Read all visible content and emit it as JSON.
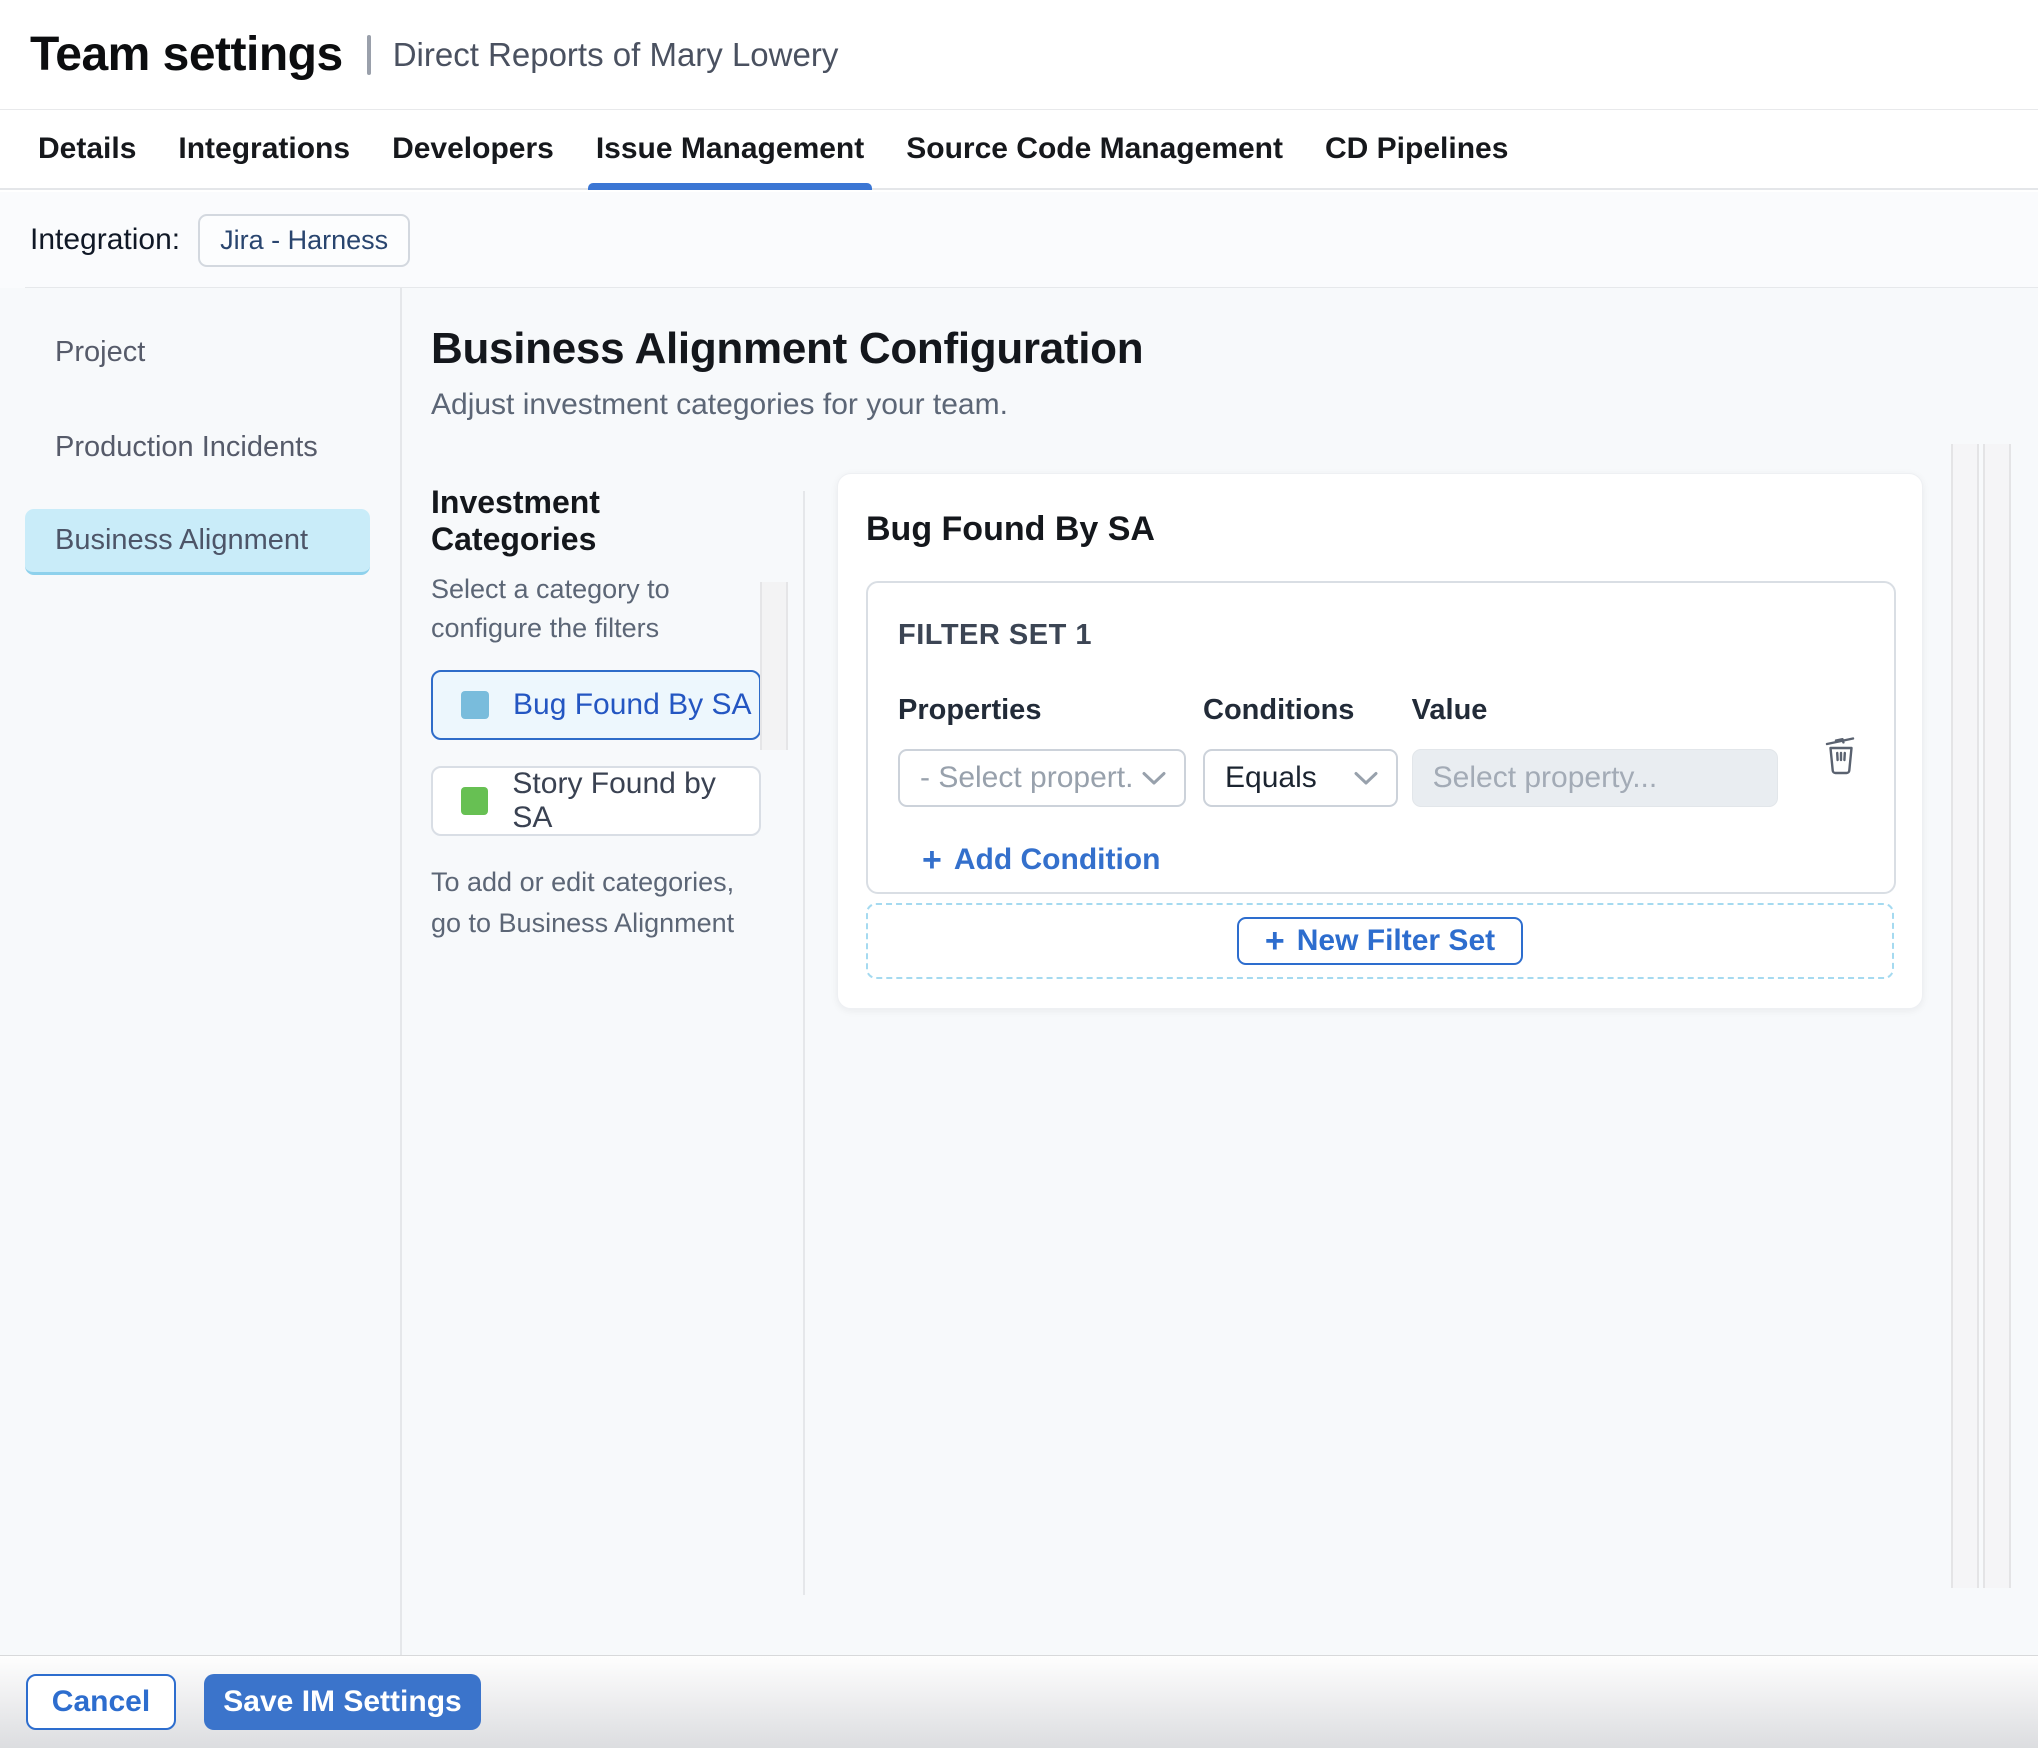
{
  "header": {
    "title": "Team settings",
    "subtitle": "Direct Reports of Mary Lowery",
    "tabs": [
      {
        "label": "Details"
      },
      {
        "label": "Integrations"
      },
      {
        "label": "Developers"
      },
      {
        "label": "Issue Management",
        "active": true
      },
      {
        "label": "Source Code Management"
      },
      {
        "label": "CD Pipelines"
      }
    ]
  },
  "integration_bar": {
    "label": "Integration:",
    "chip": "Jira - Harness"
  },
  "sidebar": {
    "items": [
      {
        "label": "Project",
        "selected": false
      },
      {
        "label": "Production Incidents",
        "selected": false
      },
      {
        "label": "Business Alignment",
        "selected": true
      }
    ]
  },
  "main": {
    "heading": "Business Alignment Configuration",
    "subheading": "Adjust investment categories for your team.",
    "categories_panel": {
      "title": "Investment Categories",
      "helper": "Select a category to configure the filters",
      "items": [
        {
          "label": "Bug Found By SA",
          "swatch_color": "#79bcdc",
          "selected": true
        },
        {
          "label": "Story Found by SA",
          "swatch_color": "#67c053",
          "selected": false
        }
      ],
      "footnote": "To add or edit categories, go to Business Alignment"
    },
    "filter_panel": {
      "title": "Bug Found By SA",
      "filter_set": {
        "label": "FILTER SET 1",
        "columns": {
          "properties": "Properties",
          "conditions": "Conditions",
          "value": "Value"
        },
        "property_placeholder": "- Select propert...",
        "condition_value": "Equals",
        "value_placeholder": "Select property...",
        "add_condition_label": "Add Condition"
      },
      "new_filter_set_label": "New Filter Set"
    }
  },
  "footer": {
    "cancel_label": "Cancel",
    "save_label": "Save IM Settings"
  },
  "icons": {
    "plus": "+"
  },
  "colors": {
    "accent_blue": "#2d6dce",
    "tab_underline": "#3b76d4",
    "save_button_bg": "#3b74cb",
    "selected_nav_bg": "#c9ecf9",
    "selected_category_bg": "#edf7fd",
    "category_swatch_blue": "#79bcdc",
    "category_swatch_green": "#67c053",
    "dashed_zone_border": "#a5daf0",
    "page_background": "#f7f9fb"
  }
}
